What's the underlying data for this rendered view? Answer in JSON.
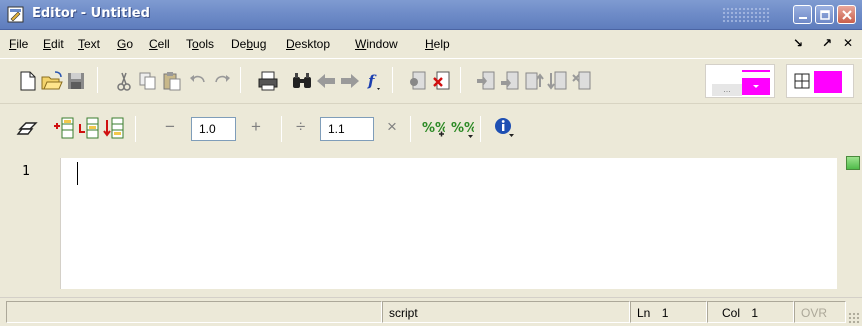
{
  "window": {
    "title": "Editor - Untitled"
  },
  "menubar": {
    "items": [
      {
        "label": "File",
        "mnemonic": "F",
        "rest": "ile"
      },
      {
        "label": "Edit",
        "mnemonic": "E",
        "rest": "dit"
      },
      {
        "label": "Text",
        "mnemonic": "T",
        "rest": "ext"
      },
      {
        "label": "Go",
        "mnemonic": "G",
        "rest": "o"
      },
      {
        "label": "Cell",
        "mnemonic": "C",
        "rest": "ell"
      },
      {
        "label": "Tools",
        "pre": "T",
        "mnemonic": "o",
        "rest": "ols"
      },
      {
        "label": "Debug",
        "pre": "De",
        "mnemonic": "b",
        "rest": "ug"
      },
      {
        "label": "Desktop",
        "mnemonic": "D",
        "rest": "esktop"
      },
      {
        "label": "Window",
        "mnemonic": "W",
        "rest": "indow"
      },
      {
        "label": "Help",
        "mnemonic": "H",
        "rest": "elp"
      }
    ],
    "right_glyphs": [
      "↘",
      "↗",
      "✕"
    ]
  },
  "toolbar1": {
    "icons": [
      "new-document-icon",
      "open-folder-icon",
      "save-icon",
      "cut-icon",
      "copy-icon",
      "paste-icon",
      "undo-icon",
      "redo-icon",
      "print-icon",
      "find-icon",
      "back-icon",
      "forward-icon",
      "function-icon",
      "set-breakpoint-icon",
      "clear-breakpoint-icon",
      "step-icon",
      "step-in-icon",
      "step-out-icon",
      "continue-icon",
      "exit-debug-icon",
      "dock-layout-icon",
      "grid-layout-icon"
    ],
    "stack_placeholder": "...",
    "accent_magenta": "#ff00ff"
  },
  "toolbar2": {
    "decrement_label": "−",
    "value_a": "1.0",
    "increment_label": "+",
    "divide_label": "÷",
    "value_b": "1.1",
    "multiply_label": "×",
    "icons": [
      "cell-mode-icon",
      "insert-cell-icon",
      "eval-cell-icon",
      "eval-advance-icon",
      "insert-comment-icon",
      "remove-comment-icon",
      "info-icon"
    ]
  },
  "editor": {
    "line_numbers": [
      "1"
    ],
    "content": ""
  },
  "statusbar": {
    "mode": "script",
    "ln_label": "Ln",
    "ln_value": "1",
    "col_label": "Col",
    "col_value": "1",
    "ovr": "OVR"
  }
}
